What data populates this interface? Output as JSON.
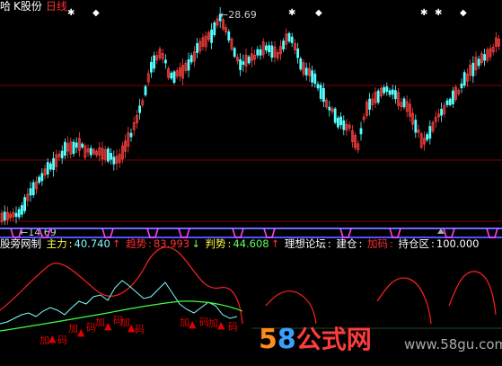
{
  "header": {
    "prefix": "哈",
    "stock_name": "K股份",
    "period": "日线"
  },
  "price_labels": {
    "high": "28.69",
    "low": "14.69"
  },
  "indicator_bar": {
    "name": "股旁网制",
    "main_label": "主力",
    "main_value": "40.740",
    "main_arrow": "↑",
    "trend_label": "趋势",
    "trend_value": "83.993",
    "trend_arrow": "↓",
    "judge_label": "判势",
    "judge_value": "44.608",
    "judge_arrow": "↑",
    "forum_label": "理想论坛",
    "open_label": "建仓",
    "add_label": "加码",
    "hold_label": "持仓区",
    "hold_value": "100.000"
  },
  "signal_marks": [
    "加",
    "▲",
    "码",
    "加",
    "▲",
    "码",
    "加",
    "▲",
    "码",
    "加",
    "▲",
    "码",
    "加",
    "▲",
    "码",
    "加",
    "▲",
    "码"
  ],
  "watermark": {
    "brand_58": "58",
    "brand_text": "公式网",
    "url": "www.58gu.com"
  },
  "colors": {
    "up": "#ff4040",
    "down": "#54ffff",
    "white": "#ffffff",
    "red": "#ff2020",
    "cyan": "#80ffff",
    "green": "#40ff40",
    "magenta": "#ff40ff",
    "yellow": "#ffff40",
    "blue": "#5050ff",
    "grid": "#800000"
  }
}
